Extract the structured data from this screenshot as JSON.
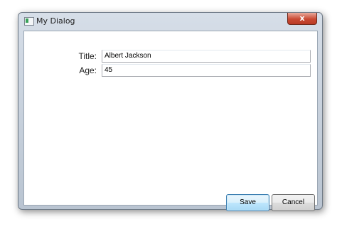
{
  "window": {
    "title": "My Dialog",
    "close_glyph": "x"
  },
  "form": {
    "title_label": "Title:",
    "title_value": "Albert Jackson",
    "age_label": "Age:",
    "age_value": "45"
  },
  "buttons": {
    "save_label": "Save",
    "cancel_label": "Cancel"
  },
  "icons": {
    "app": "window-app-icon",
    "close": "close-icon"
  },
  "colors": {
    "close_button": "#c94a33",
    "default_button_border": "#3c7fb1"
  }
}
